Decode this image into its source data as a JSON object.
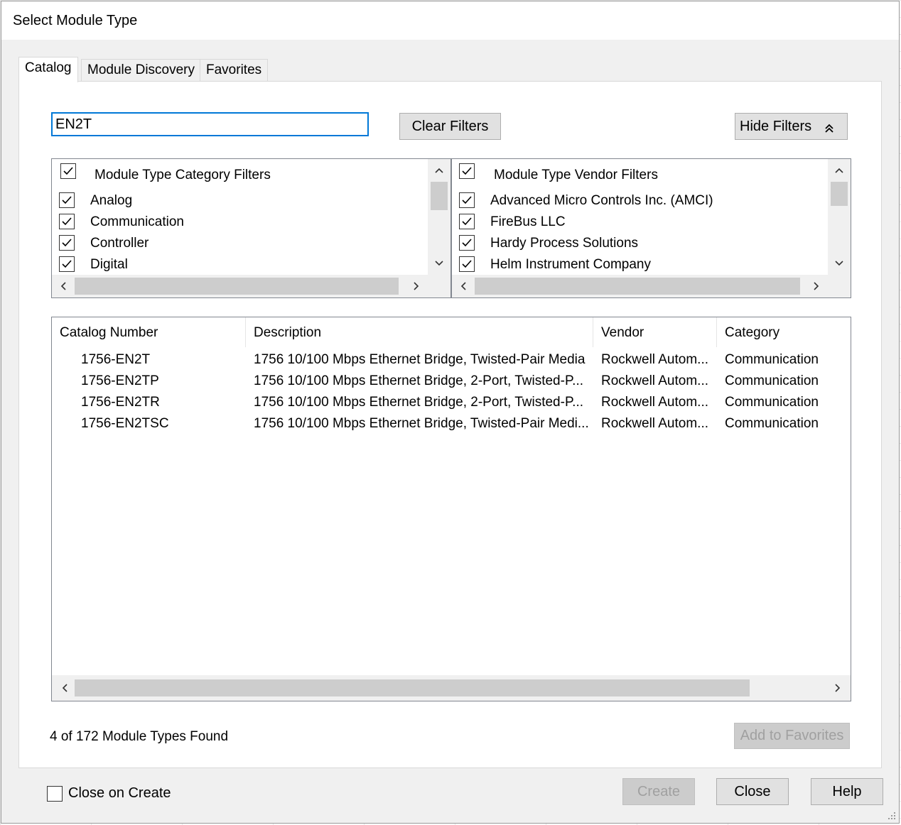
{
  "window": {
    "title": "Select Module Type"
  },
  "tabs": [
    {
      "label": "Catalog",
      "active": true
    },
    {
      "label": "Module Discovery",
      "active": false
    },
    {
      "label": "Favorites",
      "active": false
    }
  ],
  "search": {
    "value": "EN2T"
  },
  "buttons": {
    "clear_filters": "Clear Filters",
    "hide_filters": "Hide Filters",
    "add_to_favorites": "Add to Favorites",
    "create": "Create",
    "close": "Close",
    "help": "Help"
  },
  "category_filters": {
    "header": "Module Type Category Filters",
    "items": [
      {
        "label": "Analog",
        "checked": true
      },
      {
        "label": "Communication",
        "checked": true
      },
      {
        "label": "Controller",
        "checked": true
      },
      {
        "label": "Digital",
        "checked": true
      }
    ]
  },
  "vendor_filters": {
    "header": "Module Type Vendor Filters",
    "items": [
      {
        "label": "Advanced Micro Controls Inc. (AMCI)",
        "checked": true
      },
      {
        "label": "FireBus LLC",
        "checked": true
      },
      {
        "label": "Hardy Process Solutions",
        "checked": true
      },
      {
        "label": "Helm Instrument Company",
        "checked": true
      }
    ]
  },
  "results": {
    "columns": [
      "Catalog Number",
      "Description",
      "Vendor",
      "Category"
    ],
    "rows": [
      [
        "1756-EN2T",
        "1756 10/100 Mbps Ethernet Bridge, Twisted-Pair Media",
        "Rockwell Autom...",
        "Communication"
      ],
      [
        "1756-EN2TP",
        "1756 10/100 Mbps Ethernet Bridge, 2-Port, Twisted-P...",
        "Rockwell Autom...",
        "Communication"
      ],
      [
        "1756-EN2TR",
        "1756 10/100 Mbps Ethernet Bridge, 2-Port, Twisted-P...",
        "Rockwell Autom...",
        "Communication"
      ],
      [
        "1756-EN2TSC",
        "1756 10/100 Mbps Ethernet Bridge, Twisted-Pair Medi...",
        "Rockwell Autom...",
        "Communication"
      ]
    ]
  },
  "status": {
    "found_text": "4 of 172 Module Types Found"
  },
  "options": {
    "close_on_create_label": "Close on Create",
    "close_on_create_checked": false
  },
  "icons": {
    "hide_filters": "double-chevron-up-icon",
    "scroll_up": "chevron-up-icon",
    "scroll_down": "chevron-down-icon",
    "scroll_left": "chevron-left-icon",
    "scroll_right": "chevron-right-icon",
    "checkbox": "checkbox-checked-icon"
  },
  "colors": {
    "focus_border": "#0078d7",
    "window_bg": "#f0f0f0",
    "button_bg": "#e1e1e1"
  }
}
